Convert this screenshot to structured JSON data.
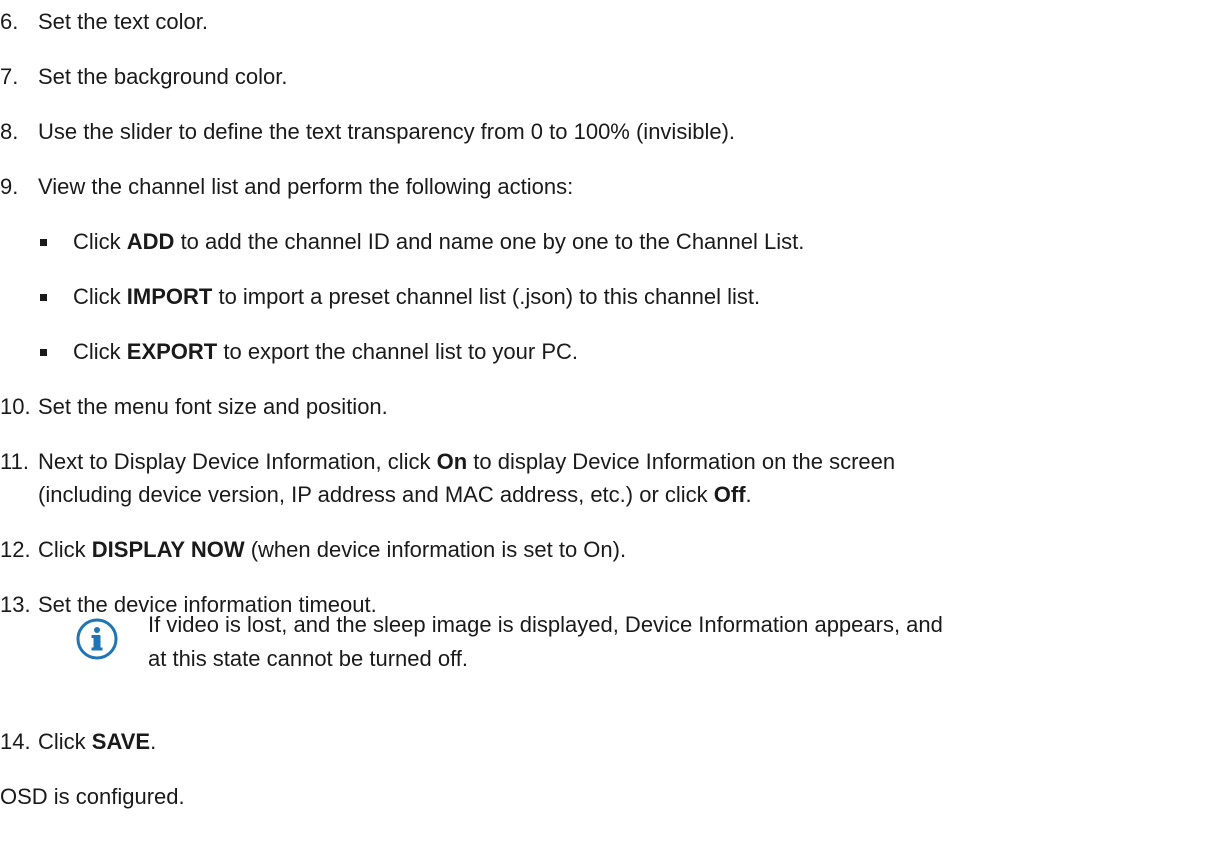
{
  "steps": [
    {
      "num": "6.",
      "text": "Set the text color."
    },
    {
      "num": "7.",
      "text": "Set the background color."
    },
    {
      "num": "8.",
      "text": "Use the slider to define the text transparency from 0 to 100% (invisible)."
    },
    {
      "num": "9.",
      "text": "View the channel list and perform the following actions:"
    }
  ],
  "bullets": [
    {
      "pre": "Click ",
      "bold": "ADD",
      "post": " to add the channel ID and name one by one to the Channel List."
    },
    {
      "pre": "Click ",
      "bold": "IMPORT",
      "post": " to import a preset channel list (.json) to this channel list."
    },
    {
      "pre": "Click ",
      "bold": "EXPORT",
      "post": " to export the channel list to your PC."
    }
  ],
  "step10": {
    "num": "10.",
    "text": "Set the menu font size and position."
  },
  "step11": {
    "num": "11.",
    "pre": "Next to Display Device Information, click ",
    "bold_on": "On",
    "mid": " to display Device Information on the screen",
    "line2_pre": "(including device version, IP address and MAC address, etc.) or click ",
    "bold_off": "Off",
    "line2_post": "."
  },
  "step12": {
    "num": "12.",
    "pre": "Click ",
    "bold": "DISPLAY NOW",
    "post": " (when device information is set to On)."
  },
  "step13": {
    "num": "13.",
    "text": "Set the device information timeout."
  },
  "note": {
    "icon": "info-icon",
    "line1": "If video is lost, and the sleep image is displayed, Device Information appears, and",
    "line2": "at this state cannot be turned off."
  },
  "step14": {
    "num": "14.",
    "pre": "Click ",
    "bold": "SAVE",
    "post": "."
  },
  "closing": "OSD is configured."
}
